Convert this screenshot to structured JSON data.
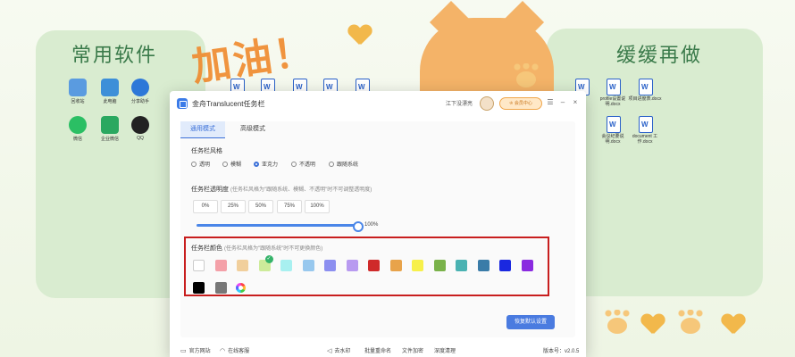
{
  "wallpaper": {
    "left_panel_title": "常用软件",
    "right_panel_title": "缓缓再做",
    "deco_text": "加油！",
    "desktop_icons_left": [
      {
        "label": "回收站",
        "color": "#5a9be0"
      },
      {
        "label": "此电脑",
        "color": "#3d8fd8"
      },
      {
        "label": "分享助手",
        "color": "#2d78d8"
      },
      {
        "label": "微信",
        "color": "#2bbf64"
      },
      {
        "label": "企业微信",
        "color": "#2aa860"
      },
      {
        "label": "QQ",
        "color": "#222222"
      }
    ],
    "desktop_docs_right": [
      {
        "label": "新建 Microsoft Word 文档.docx"
      },
      {
        "label": "profile设置说明.docx"
      },
      {
        "label": "项目进度表.docx"
      },
      {
        "label": "会议纪要说明.docx"
      },
      {
        "label": "document 工作.docx"
      }
    ]
  },
  "window": {
    "title": "金舟Translucent任务栏",
    "user_name": "江下没漂亮",
    "vip_label": "会员中心",
    "controls": {
      "menu": "☰",
      "minimize": "–",
      "close": "×"
    },
    "tabs": [
      {
        "label": "通用模式",
        "active": true
      },
      {
        "label": "高级模式",
        "active": false
      }
    ],
    "style_section": {
      "title": "任务栏风格",
      "options": [
        {
          "label": "透明",
          "selected": false
        },
        {
          "label": "模糊",
          "selected": false
        },
        {
          "label": "亚克力",
          "selected": true
        },
        {
          "label": "不透明",
          "selected": false
        },
        {
          "label": "跟随系统",
          "selected": false
        }
      ]
    },
    "opacity_section": {
      "title": "任务栏透明度",
      "hint": "(任务栏风格为\"跟随系统、模糊、不透明\"时不可调整透明度)",
      "presets": [
        "0%",
        "25%",
        "50%",
        "75%",
        "100%"
      ],
      "value_label": "100%",
      "value": 1.0
    },
    "color_section": {
      "title": "任务栏颜色",
      "hint": "(任务栏风格为\"跟随系统\"时不可更换颜色)",
      "row1": [
        "#ffffff",
        "#f4a0a8",
        "#f1cf9c",
        "#cdeb9a",
        "#a8f0f0",
        "#98c8ee",
        "#8c8ff0",
        "#b89af0",
        "#cf2a2a",
        "#e8a34a",
        "#f7f04a",
        "#7ab24a",
        "#4ab2b2",
        "#3a7ca8",
        "#1a28e0",
        "#8a2ae0"
      ],
      "selected_index": 3,
      "row2": [
        "#000000",
        "#777777"
      ],
      "custom_icon": "color-wheel-icon"
    },
    "reset_label": "恢复默认设置",
    "footer": {
      "website": "官方网站",
      "support": "在线客服",
      "links": [
        "去水印",
        "批量重命名",
        "文件加密",
        "深度清理"
      ],
      "version": "版本号：v2.0.5"
    }
  }
}
